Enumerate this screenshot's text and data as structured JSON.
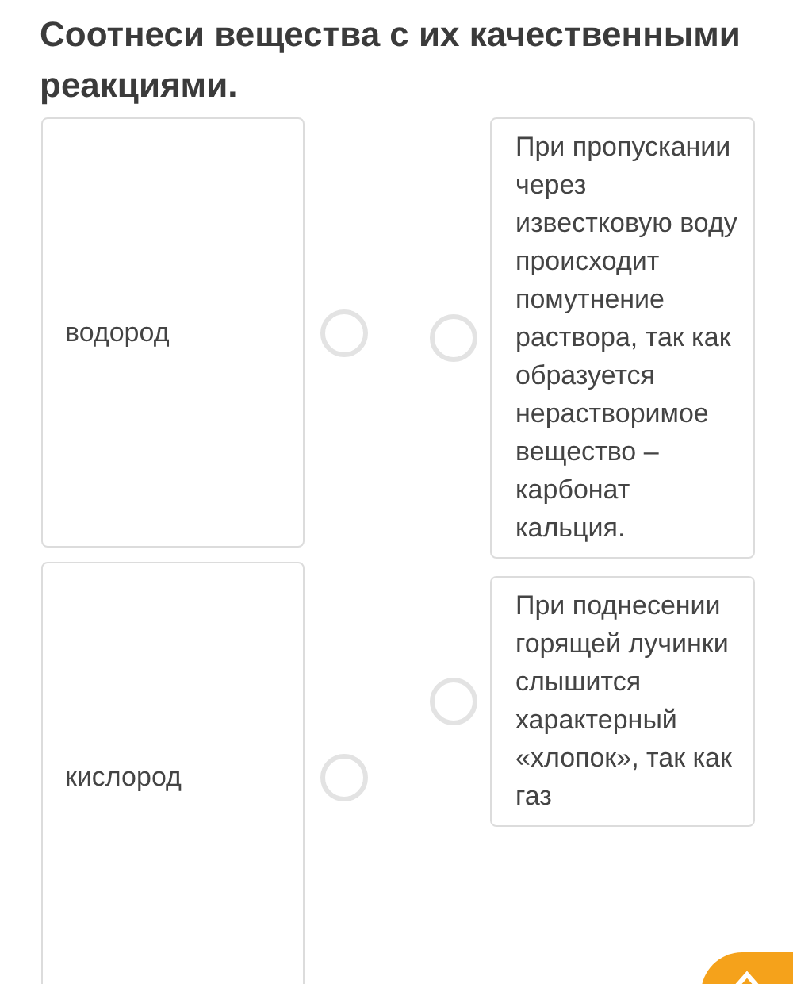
{
  "title": "Соотнеси вещества с их качественными реакциями.",
  "substances": [
    {
      "label": "водород",
      "selected": false
    },
    {
      "label": "кислород",
      "selected": false
    }
  ],
  "reactions": [
    {
      "text": "При пропускании через известковую воду происходит помутнение раствора, так как образуется нерастворимое вещество – карбонат кальция.",
      "selected": false
    },
    {
      "text": "При поднесении горящей лучинки слышится характерный «хлопок», так как газ",
      "selected": false
    }
  ]
}
